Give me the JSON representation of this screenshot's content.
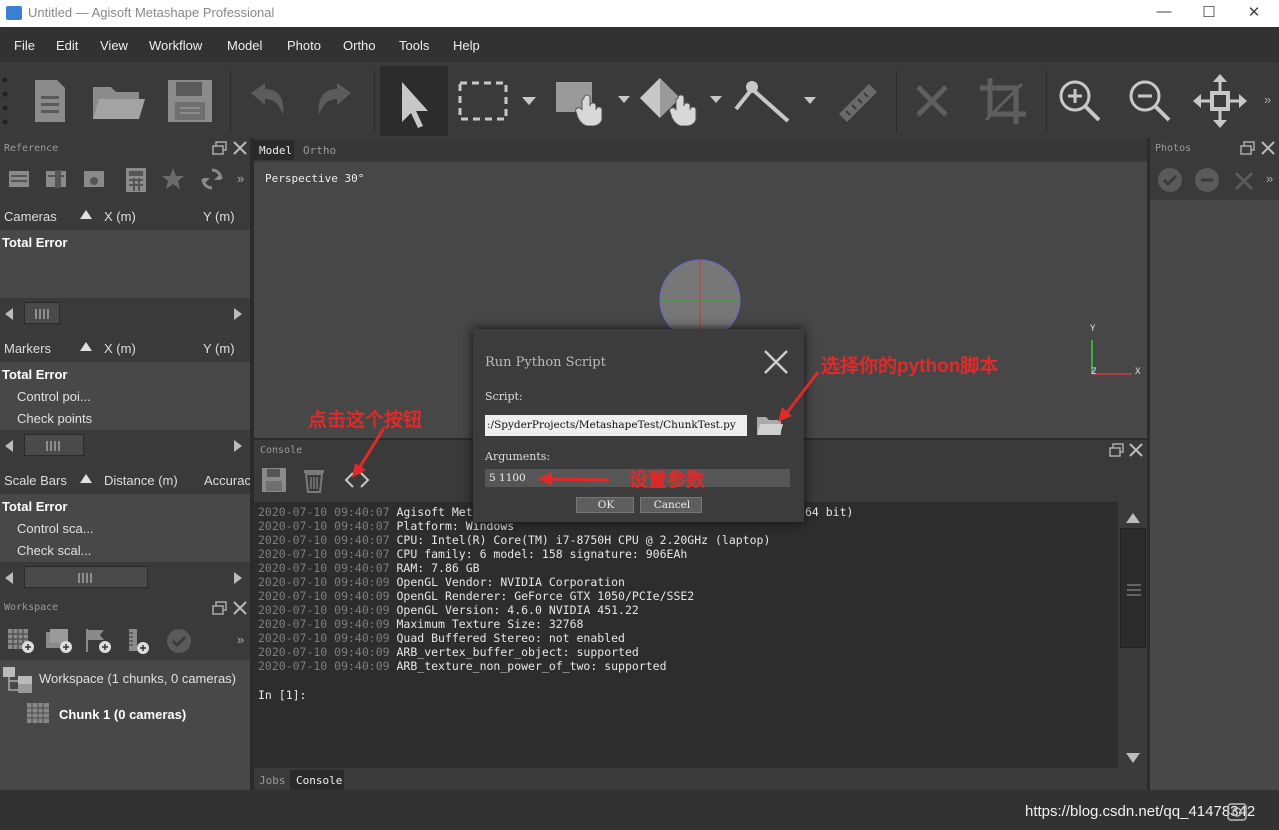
{
  "window": {
    "title": "Untitled — Agisoft Metashape Professional",
    "min": "—",
    "max": "☐",
    "close": "✕"
  },
  "menu": [
    "File",
    "Edit",
    "View",
    "Workflow",
    "Model",
    "Photo",
    "Ortho",
    "Tools",
    "Help"
  ],
  "reference": {
    "title": "Reference",
    "cameras": {
      "col1": "Cameras",
      "col2": "X (m)",
      "col3": "Y (m)",
      "total": "Total Error"
    },
    "markers": {
      "col1": "Markers",
      "col2": "X (m)",
      "col3": "Y (m)",
      "total": "Total Error",
      "rows": [
        "Control poi...",
        "Check points"
      ]
    },
    "scalebars": {
      "col1": "Scale Bars",
      "col2": "Distance (m)",
      "col3": "Accurac",
      "total": "Total Error",
      "rows": [
        "Control sca...",
        "Check scal..."
      ]
    }
  },
  "workspace": {
    "title": "Workspace",
    "root": "Workspace (1 chunks, 0 cameras)",
    "chunk": "Chunk 1 (0 cameras)"
  },
  "viewport": {
    "tab_model": "Model",
    "tab_ortho": "Ortho",
    "projection": "Perspective 30°",
    "axis_y": "Y",
    "axis_z": "Z",
    "axis_x": "X"
  },
  "photos": {
    "title": "Photos"
  },
  "console": {
    "title": "Console",
    "lines": [
      {
        "ts": "2020-07-10 09:40:07",
        "msg": "Agisoft Metashape Professional Version: 1.6.3 build 10732 (64 bit)"
      },
      {
        "ts": "2020-07-10 09:40:07",
        "msg": "Platform: Windows"
      },
      {
        "ts": "2020-07-10 09:40:07",
        "msg": "CPU: Intel(R) Core(TM) i7-8750H CPU @ 2.20GHz (laptop)"
      },
      {
        "ts": "2020-07-10 09:40:07",
        "msg": "CPU family: 6 model: 158 signature: 906EAh"
      },
      {
        "ts": "2020-07-10 09:40:07",
        "msg": "RAM: 7.86 GB"
      },
      {
        "ts": "2020-07-10 09:40:09",
        "msg": "OpenGL Vendor: NVIDIA Corporation"
      },
      {
        "ts": "2020-07-10 09:40:09",
        "msg": "OpenGL Renderer: GeForce GTX 1050/PCIe/SSE2"
      },
      {
        "ts": "2020-07-10 09:40:09",
        "msg": "OpenGL Version: 4.6.0 NVIDIA 451.22"
      },
      {
        "ts": "2020-07-10 09:40:09",
        "msg": "Maximum Texture Size: 32768"
      },
      {
        "ts": "2020-07-10 09:40:09",
        "msg": "Quad Buffered Stereo: not enabled"
      },
      {
        "ts": "2020-07-10 09:40:09",
        "msg": "ARB_vertex_buffer_object: supported"
      },
      {
        "ts": "2020-07-10 09:40:09",
        "msg": "ARB_texture_non_power_of_two: supported"
      }
    ],
    "prompt": "In [1]:",
    "tab_jobs": "Jobs",
    "tab_console": "Console"
  },
  "dialog": {
    "title": "Run Python Script",
    "script_label": "Script:",
    "script_value": ":/SpyderProjects/MetashapeTest/ChunkTest.py",
    "args_label": "Arguments:",
    "args_value": "5 1100",
    "ok": "OK",
    "cancel": "Cancel"
  },
  "annotations": {
    "choose_script": "选择你的python脚本",
    "click_button": "点击这个按钮",
    "set_args": "设置参数",
    "watermark": "https://blog.csdn.net/qq_41478342"
  },
  "colors": {
    "accent_red": "#e02a2a",
    "bg": "#2b2b2b"
  }
}
